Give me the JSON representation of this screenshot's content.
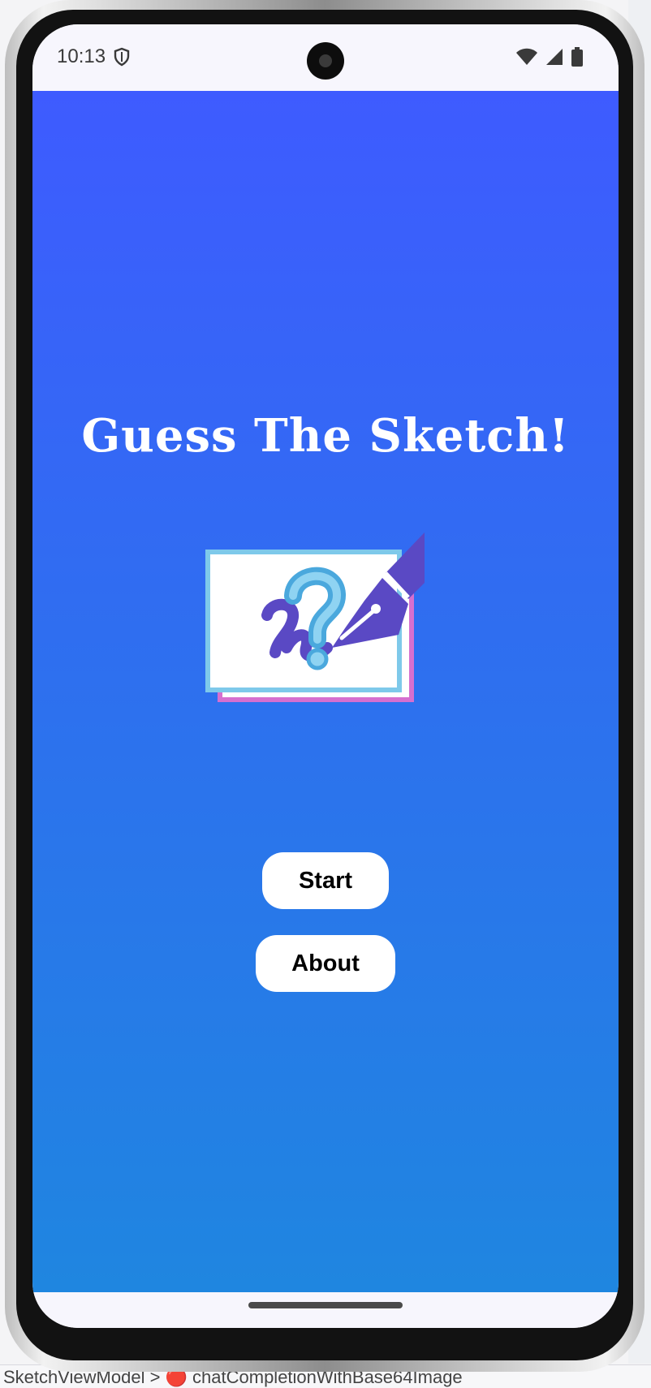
{
  "status_bar": {
    "time": "10:13",
    "icons": [
      "shield-icon",
      "wifi-icon",
      "cellular-signal-icon",
      "battery-icon"
    ]
  },
  "app": {
    "title": "Guess The Sketch!",
    "logo_icon": "question-sketch-pen-logo",
    "buttons": {
      "start_label": "Start",
      "about_label": "About"
    }
  },
  "colors": {
    "gradient_top": "#3e5bff",
    "gradient_bottom": "#1f86e0",
    "button_bg": "#ffffff",
    "title_text": "#ffffff"
  },
  "ide_footer": {
    "text": "SketchViewModel > 🔴 chatCompletionWithBase64Image"
  }
}
